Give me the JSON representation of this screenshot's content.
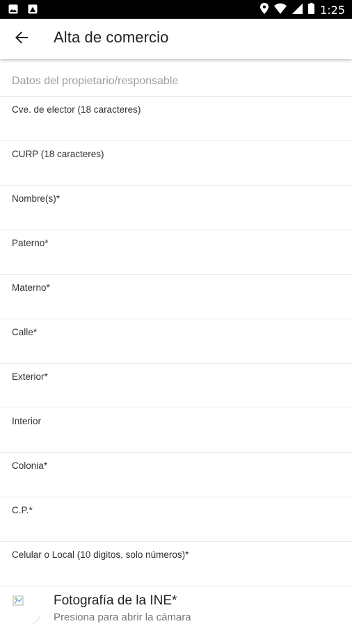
{
  "status_bar": {
    "time": "1:25",
    "icons": [
      "image-icon",
      "photo-icon",
      "location-icon",
      "wifi-icon",
      "signal-icon",
      "battery-icon"
    ]
  },
  "app_bar": {
    "back_icon": "arrow-back-icon",
    "title": "Alta de comercio"
  },
  "form": {
    "section_title": "Datos del propietario/responsable",
    "fields": [
      {
        "label": "Cve. de elector (18 caracteres)",
        "value": ""
      },
      {
        "label": "CURP (18 caracteres)",
        "value": ""
      },
      {
        "label": "Nombre(s)*",
        "value": ""
      },
      {
        "label": "Paterno*",
        "value": ""
      },
      {
        "label": "Materno*",
        "value": ""
      },
      {
        "label": "Calle*",
        "value": ""
      },
      {
        "label": "Exterior*",
        "value": ""
      },
      {
        "label": "Interior",
        "value": ""
      },
      {
        "label": "Colonia*",
        "value": ""
      },
      {
        "label": "C.P.*",
        "value": ""
      },
      {
        "label": "Celular o Local (10 digitos, solo números)*",
        "value": ""
      }
    ]
  },
  "photo": {
    "title": "Fotografía de la INE*",
    "subtitle": "Presiona para abrir la cámara",
    "icon": "broken-image-icon"
  },
  "colors": {
    "status_bar": "#000000",
    "header_text": "#9e9e9e",
    "divider": "#ececec",
    "text": "#212121"
  }
}
